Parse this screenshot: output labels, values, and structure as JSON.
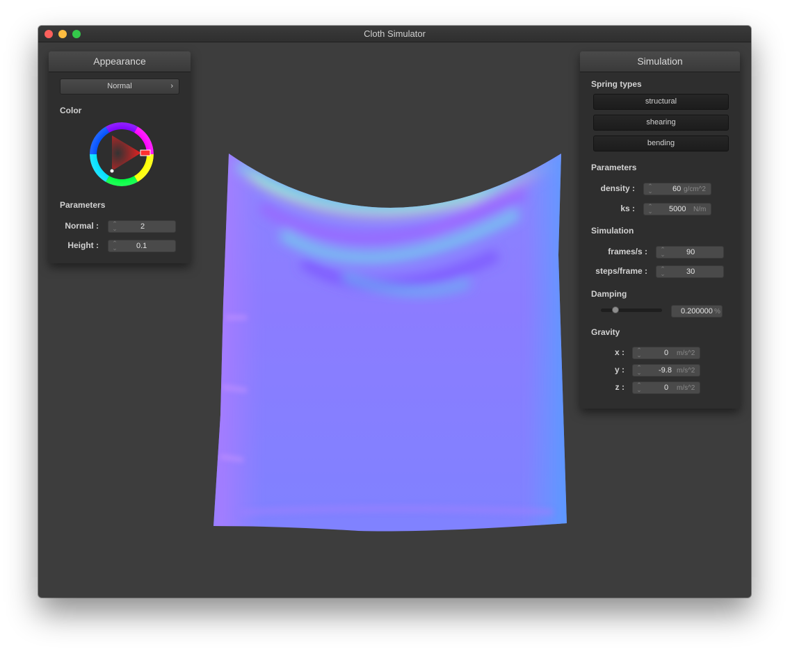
{
  "window": {
    "title": "Cloth Simulator"
  },
  "appearance": {
    "header": "Appearance",
    "shader_dropdown": {
      "value": "Normal",
      "arrow": "›"
    },
    "color_label": "Color",
    "color_value": "#ff2a2a",
    "params_label": "Parameters",
    "normal": {
      "label": "Normal :",
      "value": "2"
    },
    "height": {
      "label": "Height :",
      "value": "0.1"
    }
  },
  "simulation": {
    "header": "Simulation",
    "spring_types_label": "Spring types",
    "spring_buttons": [
      "structural",
      "shearing",
      "bending"
    ],
    "params_label": "Parameters",
    "density": {
      "label": "density :",
      "value": "60",
      "unit": "g/cm^2"
    },
    "ks": {
      "label": "ks :",
      "value": "5000",
      "unit": "N/m"
    },
    "simulation_label": "Simulation",
    "fps": {
      "label": "frames/s :",
      "value": "90"
    },
    "steps": {
      "label": "steps/frame :",
      "value": "30"
    },
    "damping_label": "Damping",
    "damping": {
      "value": "0.200000",
      "unit": "%",
      "slider_fraction": 0.2
    },
    "gravity_label": "Gravity",
    "gx": {
      "label": "x :",
      "value": "0",
      "unit": "m/s^2"
    },
    "gy": {
      "label": "y :",
      "value": "-9.8",
      "unit": "m/s^2"
    },
    "gz": {
      "label": "z :",
      "value": "0",
      "unit": "m/s^2"
    }
  },
  "colors": {
    "background": "#3d3d3d",
    "panel": "#2e2e2e",
    "cloth_base": "#8a7dff"
  }
}
